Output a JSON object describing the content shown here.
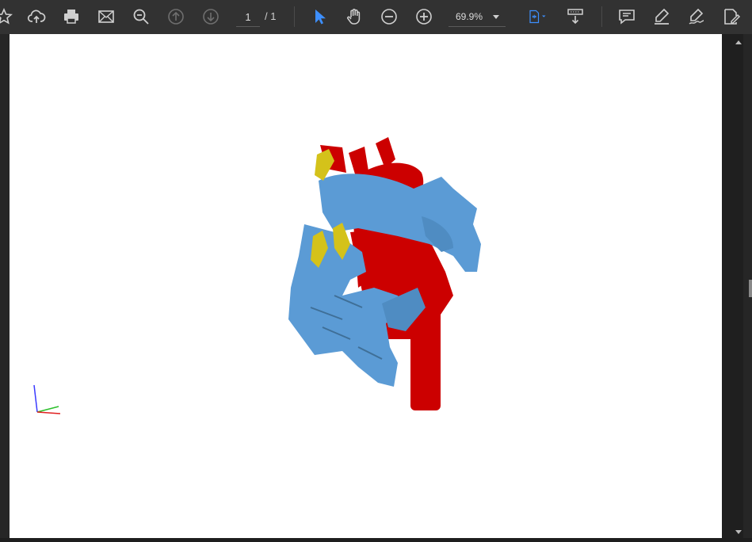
{
  "toolbar": {
    "page_current": "1",
    "page_total": "/ 1",
    "zoom": "69.9%",
    "icons": [
      "star-icon",
      "cloud-upload-icon",
      "print-icon",
      "mail-icon",
      "search-icon",
      "page-up-icon",
      "page-down-icon",
      "select-cursor-icon",
      "hand-tool-icon",
      "zoom-out-icon",
      "zoom-in-icon",
      "fit-page-icon",
      "scroll-mode-icon",
      "comment-icon",
      "highlight-icon",
      "sign-icon",
      "edit-pdf-icon"
    ]
  },
  "colors": {
    "toolbar_bg": "#323232",
    "accent": "#4a9eff",
    "vessel_red": "#cc0000",
    "chamber_blue": "#5b9bd5",
    "valve_yellow": "#d4c21a"
  },
  "model": {
    "description_icon": "3d-heart-model"
  }
}
